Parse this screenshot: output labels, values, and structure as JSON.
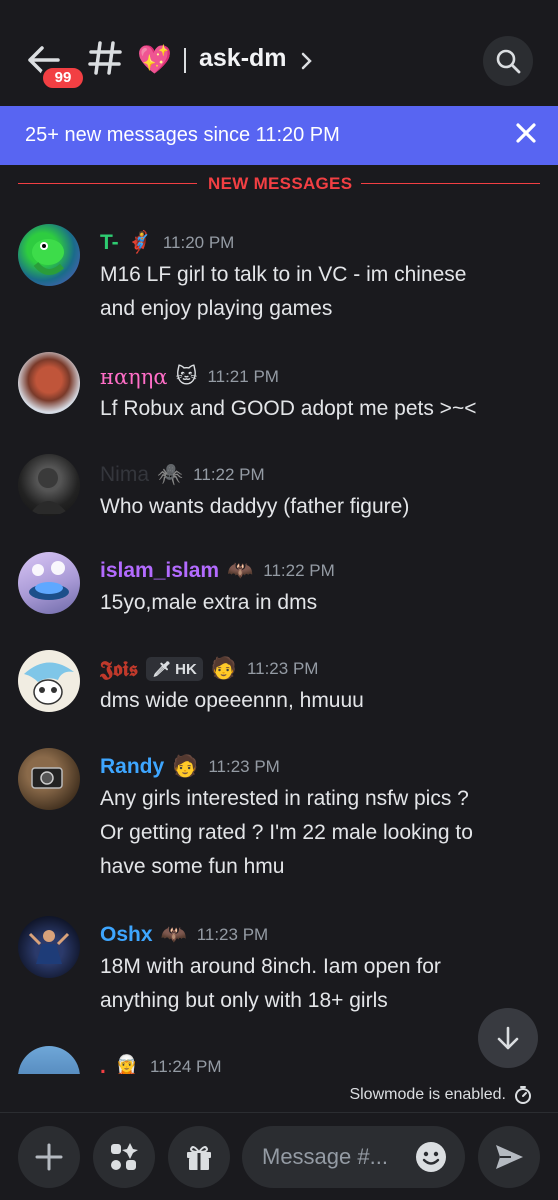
{
  "header": {
    "back_badge": "99",
    "channel_emoji": "💖",
    "channel_name": "ask-dm"
  },
  "banner": {
    "text": "25+ new messages since 11:20 PM"
  },
  "divider": {
    "label": "NEW MESSAGES"
  },
  "messages": [
    {
      "username": "T-",
      "name_color": "#2ecc71",
      "badge": "🦸",
      "time": "11:20 PM",
      "lines": [
        "M16 LF girl to talk to in VC - im chinese",
        "and enjoy playing games"
      ]
    },
    {
      "username": "нαηηα",
      "name_color": "#ff6ec7",
      "badge": "🐱",
      "time": "11:21 PM",
      "lines": [
        "Lf Robux and GOOD adopt me pets >~<"
      ]
    },
    {
      "username": "Nima",
      "name_color": "#3a3c42",
      "badge": "🕷️",
      "time": "11:22 PM",
      "lines": [
        "Who wants daddyy (father figure)"
      ]
    },
    {
      "username": "islam_islam",
      "name_color": "#b36bff",
      "badge": "🦇",
      "time": "11:22 PM",
      "lines": [
        "15yo,male extra in dms"
      ]
    },
    {
      "username": "𝕵𝖔𝖎𝖘",
      "name_color": "#c0392b",
      "tag_text": "HK",
      "badge": "🧑",
      "time": "11:23 PM",
      "lines": [
        "dms wide opeeennn, hmuuu"
      ]
    },
    {
      "username": "Randy",
      "name_color": "#3ea6ff",
      "badge": "🧑",
      "time": "11:23 PM",
      "lines": [
        "Any girls interested in rating nsfw pics ?",
        "Or getting rated ? I'm 22 male looking to",
        "have some fun hmu"
      ]
    },
    {
      "username": "Oshx",
      "name_color": "#3ea6ff",
      "badge": "🦇",
      "time": "11:23 PM",
      "lines": [
        "18M with around 8inch. Iam open for",
        "anything but only with 18+ girls"
      ]
    },
    {
      "username": ".",
      "name_color": "#f23f43",
      "badge": "🧝",
      "time": "11:24 PM",
      "lines": []
    }
  ],
  "slowmode": "Slowmode is enabled.",
  "composer": {
    "placeholder": "Message #..."
  }
}
